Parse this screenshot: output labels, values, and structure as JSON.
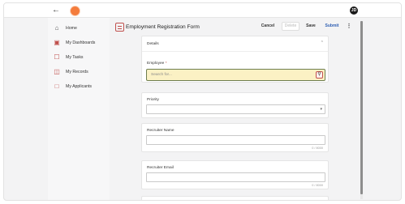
{
  "topbar": {
    "back_icon": "arrow-left-icon",
    "avatar_initials": "JD",
    "brand_color": "#f47c3c"
  },
  "sidebar": {
    "items": [
      {
        "label": "Home",
        "icon": "home-icon"
      },
      {
        "label": "My Dashboards",
        "icon": "dashboard-icon"
      },
      {
        "label": "My Tasks",
        "icon": "tasks-icon"
      },
      {
        "label": "My Records",
        "icon": "records-icon"
      },
      {
        "label": "My Applicants",
        "icon": "applicants-icon"
      }
    ]
  },
  "form": {
    "title": "Employment Registration Form",
    "toolbar": {
      "cancel": "Cancel",
      "delete": "Delete",
      "save": "Save",
      "submit": "Submit",
      "more": "⋮"
    }
  },
  "details": {
    "section_title": "Details",
    "employee_label": "Employee",
    "required_mark": "*",
    "employee_placeholder": "Search for..."
  },
  "priority": {
    "label": "Priority",
    "value": ""
  },
  "recruiter_name": {
    "label": "Recruiter Name",
    "value": "",
    "counter": "0 / 8000"
  },
  "recruiter_email": {
    "label": "Recruiter Email",
    "value": "",
    "counter": "0 / 8000"
  },
  "colors": {
    "accent": "#c0504d",
    "submit": "#2f5fb3",
    "search_bg": "#fbf1c4"
  }
}
